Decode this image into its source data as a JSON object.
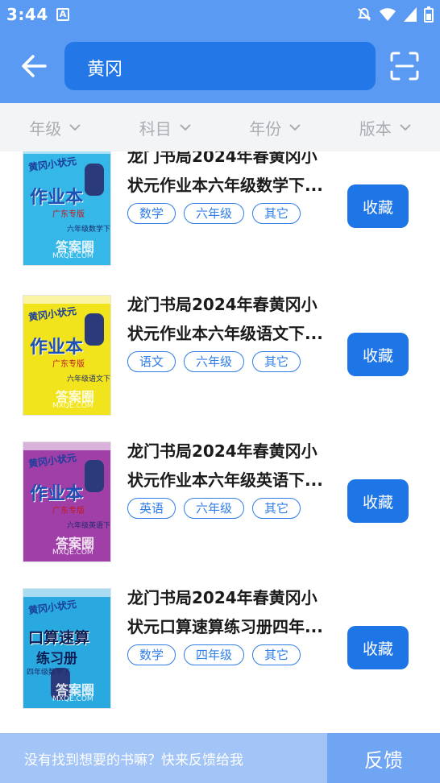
{
  "status_bar": {
    "time": "3:44",
    "notif_glyph": "A"
  },
  "search": {
    "query": "黄冈"
  },
  "filters": [
    {
      "label": "年级"
    },
    {
      "label": "科目"
    },
    {
      "label": "年份"
    },
    {
      "label": "版本"
    }
  ],
  "books": [
    {
      "title_line1": "龙门书局2024年春黄冈小",
      "title_line2": "状元作业本六年级数学下...",
      "tags": [
        "数学",
        "六年级",
        "其它"
      ],
      "fav_label": "收藏",
      "cover": {
        "color": "#35b7e8",
        "brand": "黄冈小状元",
        "title": "作业本",
        "sub": "广东专版",
        "meta": "六年级数学下"
      }
    },
    {
      "title_line1": "龙门书局2024年春黄冈小",
      "title_line2": "状元作业本六年级语文下...",
      "tags": [
        "语文",
        "六年级",
        "其它"
      ],
      "fav_label": "收藏",
      "cover": {
        "color": "#f2e41c",
        "brand": "黄冈小状元",
        "title": "作业本",
        "sub": "广东专版",
        "meta": "六年级语文下"
      }
    },
    {
      "title_line1": "龙门书局2024年春黄冈小",
      "title_line2": "状元作业本六年级英语下...",
      "tags": [
        "英语",
        "六年级",
        "其它"
      ],
      "fav_label": "收藏",
      "cover": {
        "color": "#a13fa8",
        "brand": "黄冈小状元",
        "title": "作业本",
        "sub": "广东专版",
        "meta": "六年级英语下"
      }
    },
    {
      "title_line1": "龙门书局2024年春黄冈小",
      "title_line2": "状元口算速算练习册四年...",
      "tags": [
        "数学",
        "四年级",
        "其它"
      ],
      "fav_label": "收藏",
      "cover": {
        "color": "#2aa9e0",
        "brand": "黄冈小状元",
        "title": "口算速算",
        "sub": "练习册",
        "meta": "四年级数学下"
      }
    }
  ],
  "footer": {
    "message": "没有找到想要的书嘛？快来反馈给我",
    "button": "反馈"
  }
}
